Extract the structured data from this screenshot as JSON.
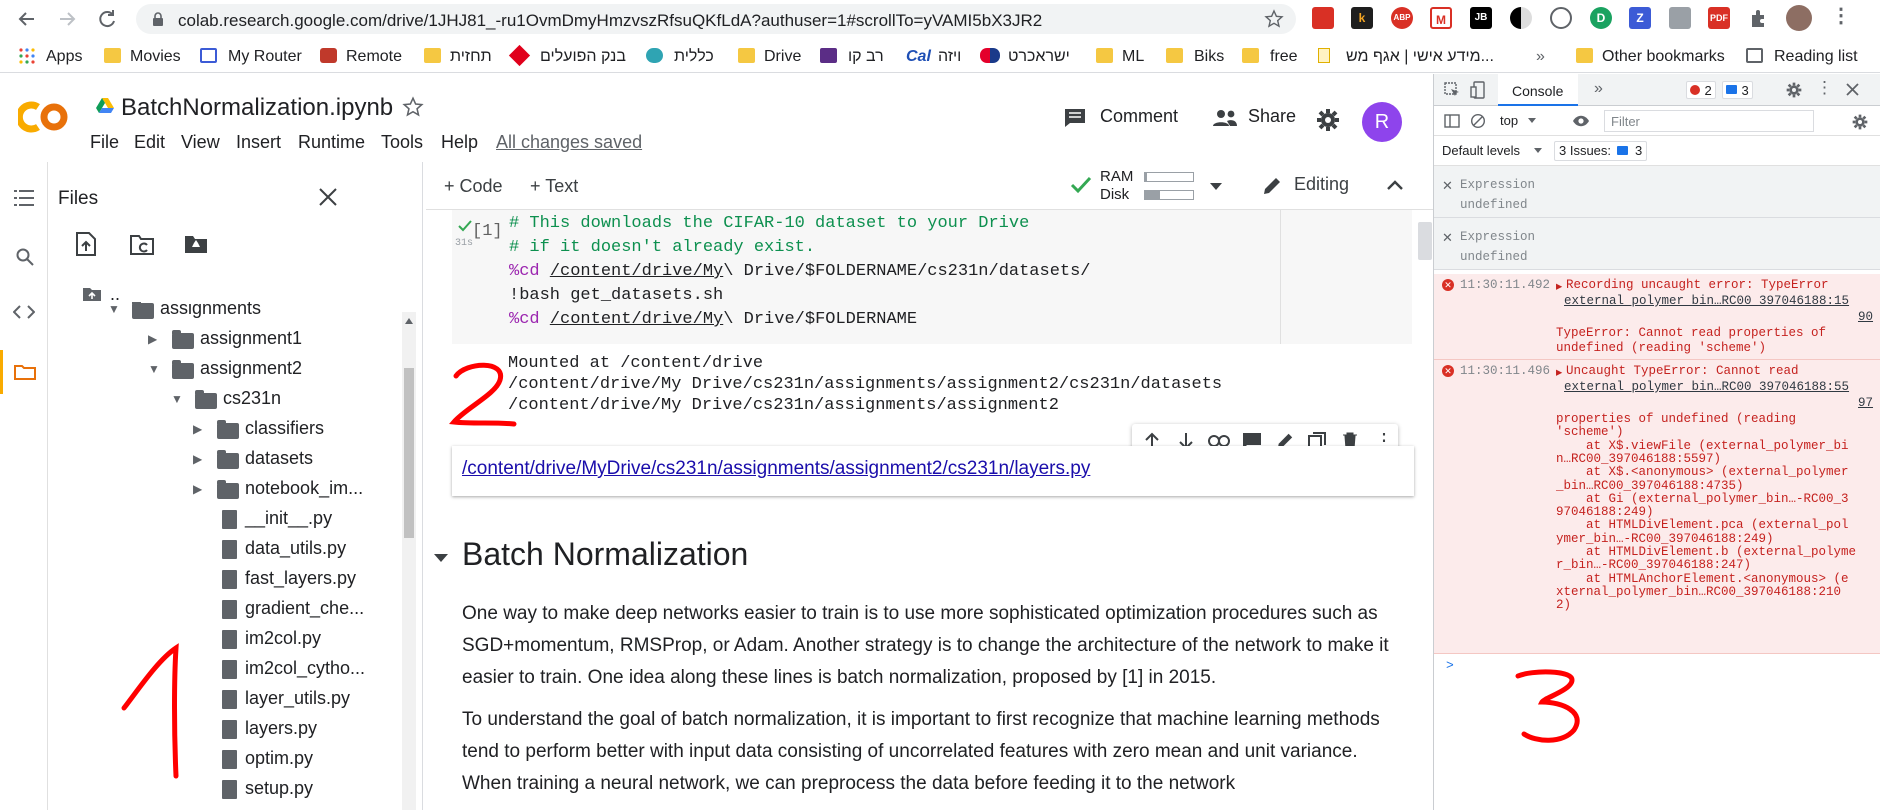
{
  "browser": {
    "url": "colab.research.google.com/drive/1JHJ81_-ru1OvmDmyHmzvszRfsuQKfLdA?authuser=1#scrollTo=yVAMI5bX3JR2",
    "bookmarks": [
      {
        "label": "Apps",
        "icon": "apps-grid-icon"
      },
      {
        "label": "Movies",
        "icon": "folder-icon"
      },
      {
        "label": "My Router",
        "icon": "router-icon"
      },
      {
        "label": "Remote",
        "icon": "remote-icon"
      },
      {
        "label": "תחזית",
        "icon": "folder-icon"
      },
      {
        "label": "בנק הפועלים",
        "icon": "bank-icon"
      },
      {
        "label": "כללית",
        "icon": "clalit-icon"
      },
      {
        "label": "Drive",
        "icon": "folder-icon"
      },
      {
        "label": "רב קו",
        "icon": "ravkav-icon"
      },
      {
        "label": "ויזה",
        "icon": "cal-icon"
      },
      {
        "label": "ישראכרט",
        "icon": "isracard-icon"
      },
      {
        "label": "ML",
        "icon": "folder-icon"
      },
      {
        "label": "Biks",
        "icon": "folder-icon"
      },
      {
        "label": "free",
        "icon": "folder-icon"
      },
      {
        "label": "מידע אישי | אגף מש...",
        "icon": "page-icon"
      }
    ],
    "more_label": "»",
    "other_bookmarks": "Other bookmarks",
    "reading_list": "Reading list",
    "cal_text": "Cal"
  },
  "colab": {
    "logo_text": "CO",
    "notebook_title": "BatchNormalization.ipynb",
    "menu": [
      "File",
      "Edit",
      "View",
      "Insert",
      "Runtime",
      "Tools",
      "Help"
    ],
    "saved_status": "All changes saved",
    "comment_label": "Comment",
    "share_label": "Share",
    "avatar_letter": "R",
    "add_code": "+ Code",
    "add_text": "+ Text",
    "ram_label": "RAM",
    "disk_label": "Disk",
    "ram_usage": 0.04,
    "disk_usage": 0.32,
    "editing_label": "Editing",
    "accent_orange": "#f9ab00",
    "avatar_color": "#8e44ec"
  },
  "files_panel": {
    "title": "Files",
    "parent_label": "..",
    "tree": [
      {
        "label": "assignments",
        "type": "folder",
        "expanded": true
      },
      {
        "label": "assignment1",
        "type": "folder",
        "expanded": false
      },
      {
        "label": "assignment2",
        "type": "folder",
        "expanded": true
      },
      {
        "label": "cs231n",
        "type": "folder",
        "expanded": true
      },
      {
        "label": "classifiers",
        "type": "folder",
        "expanded": false
      },
      {
        "label": "datasets",
        "type": "folder",
        "expanded": false
      },
      {
        "label": "notebook_im...",
        "type": "folder",
        "expanded": false
      },
      {
        "label": "__init__.py",
        "type": "file"
      },
      {
        "label": "data_utils.py",
        "type": "file"
      },
      {
        "label": "fast_layers.py",
        "type": "file"
      },
      {
        "label": "gradient_che...",
        "type": "file"
      },
      {
        "label": "im2col.py",
        "type": "file"
      },
      {
        "label": "im2col_cytho...",
        "type": "file"
      },
      {
        "label": "layer_utils.py",
        "type": "file"
      },
      {
        "label": "layers.py",
        "type": "file"
      },
      {
        "label": "optim.py",
        "type": "file"
      },
      {
        "label": "setup.py",
        "type": "file"
      }
    ]
  },
  "notebook": {
    "cell_exec_count": "[1]",
    "cell_time": "31s",
    "code_lines": [
      "# This downloads the CIFAR-10 dataset to your Drive",
      "# if it doesn't already exist.",
      "%cd /content/drive/My\\ Drive/$FOLDERNAME/cs231n/datasets/",
      "!bash get_datasets.sh",
      "%cd /content/drive/My\\ Drive/$FOLDERNAME"
    ],
    "output_lines": [
      "Mounted at /content/drive",
      "/content/drive/My Drive/cs231n/assignments/assignment2/cs231n/datasets",
      "/content/drive/My Drive/cs231n/assignments/assignment2"
    ],
    "link_text": "/content/drive/MyDrive/cs231n/assignments/assignment2/cs231n/layers.py",
    "heading": "Batch Normalization",
    "paragraph1": "One way to make deep networks easier to train is to use more sophisticated optimization procedures such as SGD+momentum, RMSProp, or Adam. Another strategy is to change the architecture of the network to make it easier to train. One idea along these lines is batch normalization, proposed by [1] in 2015.",
    "paragraph2": "To understand the goal of batch normalization, it is important to first recognize that machine learning methods tend to perform better with input data consisting of uncorrelated features with zero mean and unit variance. When training a neural network, we can preprocess the data before feeding it to the network"
  },
  "devtools": {
    "console_tab": "Console",
    "more_tabs": "»",
    "error_count": "2",
    "issue_count_badge": "3",
    "context": "top",
    "filter_placeholder": "Filter",
    "levels": "Default levels",
    "issues_label": "3 Issues:",
    "issues_count": "3",
    "expressions": [
      {
        "label": "Expression",
        "value": "undefined"
      },
      {
        "label": "Expression",
        "value": "undefined"
      }
    ],
    "errors": [
      {
        "time": "11:30:11.492",
        "message": "Recording uncaught error: TypeError",
        "source1": "external_polymer_bin…RC00_397046188:15",
        "source2": "90",
        "detail1": "TypeError: Cannot read properties of",
        "detail2": "undefined (reading 'scheme')"
      },
      {
        "time": "11:30:11.496",
        "message": "Uncaught TypeError: Cannot read",
        "source1": "external_polymer_bin…RC00_397046188:55",
        "source2": "97",
        "stack": [
          "properties of undefined (reading",
          "'scheme')",
          "    at X$.viewFile (external_polymer_bi",
          "n…RC00_397046188:5597)",
          "    at X$.<anonymous> (external_polymer",
          "_bin…RC00_397046188:4735)",
          "    at Gi (external_polymer_bin…-RC00_3",
          "97046188:249)",
          "    at HTMLDivElement.pca (external_pol",
          "ymer_bin…-RC00_397046188:249)",
          "    at HTMLDivElement.b (external_polyme",
          "r_bin…-RC00_397046188:247)",
          "    at HTMLAnchorElement.<anonymous> (e",
          "xternal_polymer_bin…RC00_397046188:210",
          "2)"
        ]
      }
    ],
    "prompt": ">"
  },
  "annotations": [
    {
      "label": "1",
      "color": "#ff0000"
    },
    {
      "label": "2",
      "color": "#ff0000"
    },
    {
      "label": "3",
      "color": "#ff0000"
    }
  ]
}
